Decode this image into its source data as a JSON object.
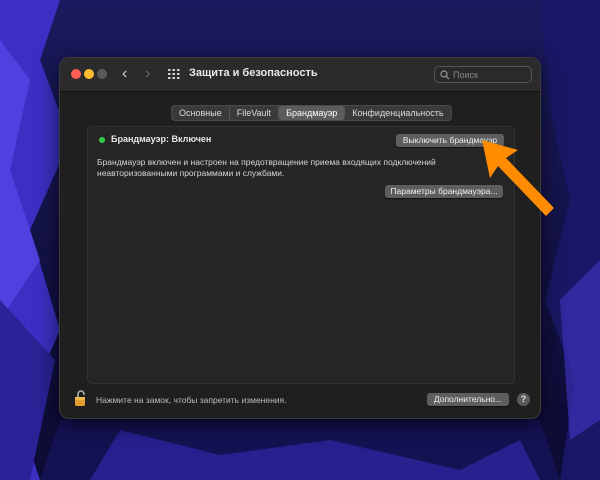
{
  "window": {
    "title": "Защита и безопасность",
    "search_placeholder": "Поиск"
  },
  "tabs": [
    {
      "label": "Основные",
      "active": false
    },
    {
      "label": "FileVault",
      "active": false
    },
    {
      "label": "Брандмауэр",
      "active": true
    },
    {
      "label": "Конфиденциальность",
      "active": false
    }
  ],
  "firewall": {
    "status": "Брандмауэр: Включен",
    "status_color": "#2fcb48",
    "turn_off_button": "Выключить брандмауэр",
    "description_line1": "Брандмауэр включен и настроен на предотвращение приема входящих подключений",
    "description_line2": "неавторизованными программами и службами.",
    "options_button": "Параметры брандмауэра..."
  },
  "footer": {
    "lock_text": "Нажмите на замок, чтобы запретить изменения.",
    "advanced_button": "Дополнительно...",
    "help": "?"
  },
  "annotation": {
    "arrow_color": "#ff8c00"
  }
}
